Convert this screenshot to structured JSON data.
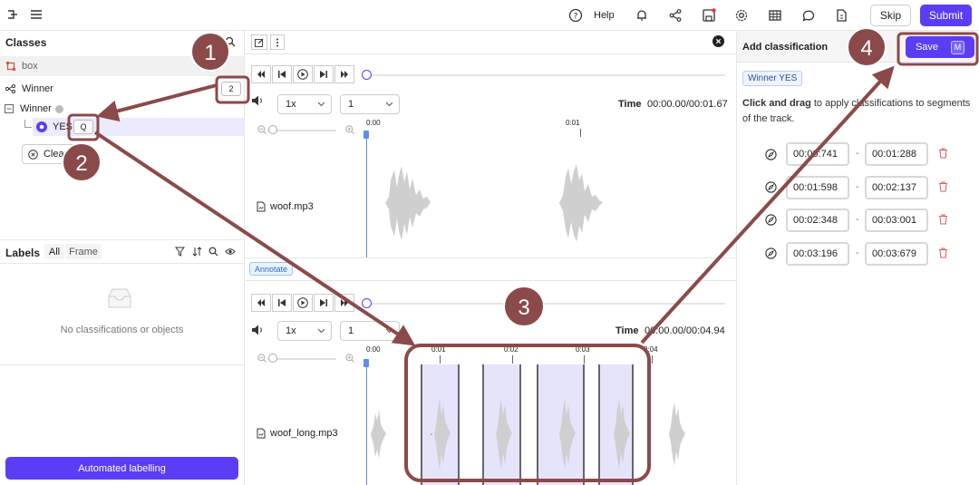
{
  "topbar": {
    "help_label": "Help",
    "skip_label": "Skip",
    "submit_label": "Submit",
    "accent_color": "#5b3df5"
  },
  "classes": {
    "title": "Classes",
    "box_label": "box",
    "winner_class_label": "Winner",
    "winner_class_hotkey": "2",
    "winner_group_label": "Winner",
    "yes_option_label": "YES",
    "yes_option_hotkey": "Q",
    "clear_label": "Clear"
  },
  "labels": {
    "title": "Labels",
    "tab_all": "All",
    "tab_frame": "Frame",
    "empty_text": "No classifications or objects",
    "automated_button": "Automated labelling"
  },
  "track1": {
    "speed": "1x",
    "channel": "1",
    "time_label": "Time",
    "time_value": "00:00.00/00:01.67",
    "tick_0": "0:00",
    "tick_1": "0:01",
    "file_name": "woof.mp3"
  },
  "annotate_badge": "Annotate",
  "track2": {
    "speed": "1x",
    "channel": "1",
    "time_label": "Time",
    "time_value": "00:00.00/00:04.94",
    "ticks": [
      "0:00",
      "0:01",
      "0:02",
      "0:03",
      "0:04"
    ],
    "file_name": "woof_long.mp3"
  },
  "classification": {
    "title": "Add classification",
    "save_label": "Save",
    "save_hotkey": "M",
    "tag_label": "Winner YES",
    "instructions_bold": "Click and drag",
    "instructions_rest": " to apply classifications to segments of the track.",
    "segments": [
      {
        "start": "00:00:741",
        "end": "00:01:288"
      },
      {
        "start": "00:01:598",
        "end": "00:02:137"
      },
      {
        "start": "00:02:348",
        "end": "00:03:001"
      },
      {
        "start": "00:03:196",
        "end": "00:03:679"
      }
    ],
    "separator": "-"
  },
  "callouts": [
    "1",
    "2",
    "3",
    "4"
  ],
  "callout_color": "#8b4a4a"
}
